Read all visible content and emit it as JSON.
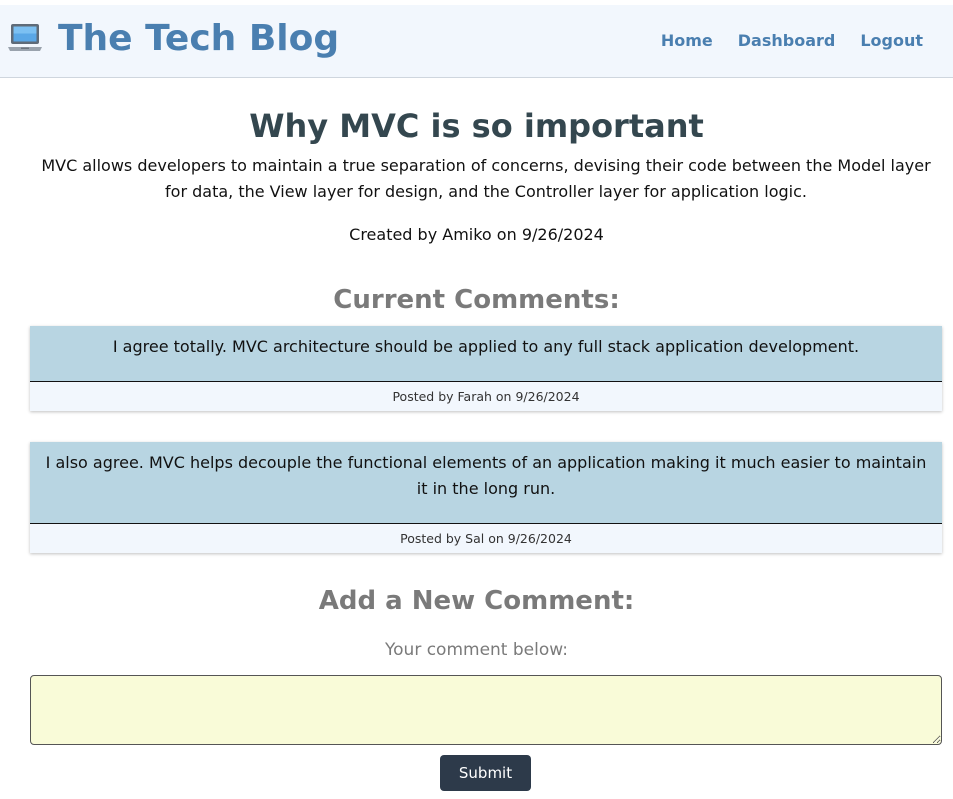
{
  "header": {
    "title": "The Tech Blog",
    "icon": "laptop-icon",
    "nav": {
      "home": "Home",
      "dashboard": "Dashboard",
      "logout": "Logout"
    }
  },
  "post": {
    "title": "Why MVC is so important",
    "body": "MVC allows developers to maintain a true separation of concerns, devising their code between the Model layer for data, the View layer for design, and the Controller layer for application logic.",
    "meta": "Created by Amiko on 9/26/2024"
  },
  "comments": {
    "heading": "Current Comments:",
    "items": [
      {
        "text": "I agree totally. MVC architecture should be applied to any full stack application development.",
        "footer": "Posted by Farah on 9/26/2024"
      },
      {
        "text": "I also agree. MVC helps decouple the functional elements of an application making it much easier to maintain it in the long run.",
        "footer": "Posted by Sal on 9/26/2024"
      }
    ]
  },
  "new_comment": {
    "heading": "Add a New Comment:",
    "label": "Your comment below:",
    "value": "",
    "submit_label": "Submit"
  },
  "colors": {
    "brand": "#4a7fb0",
    "navbar_bg": "#f2f7fd",
    "comment_bg": "#b8d5e2",
    "input_bg": "#f9fbd8",
    "button_bg": "#2d3a4a"
  }
}
